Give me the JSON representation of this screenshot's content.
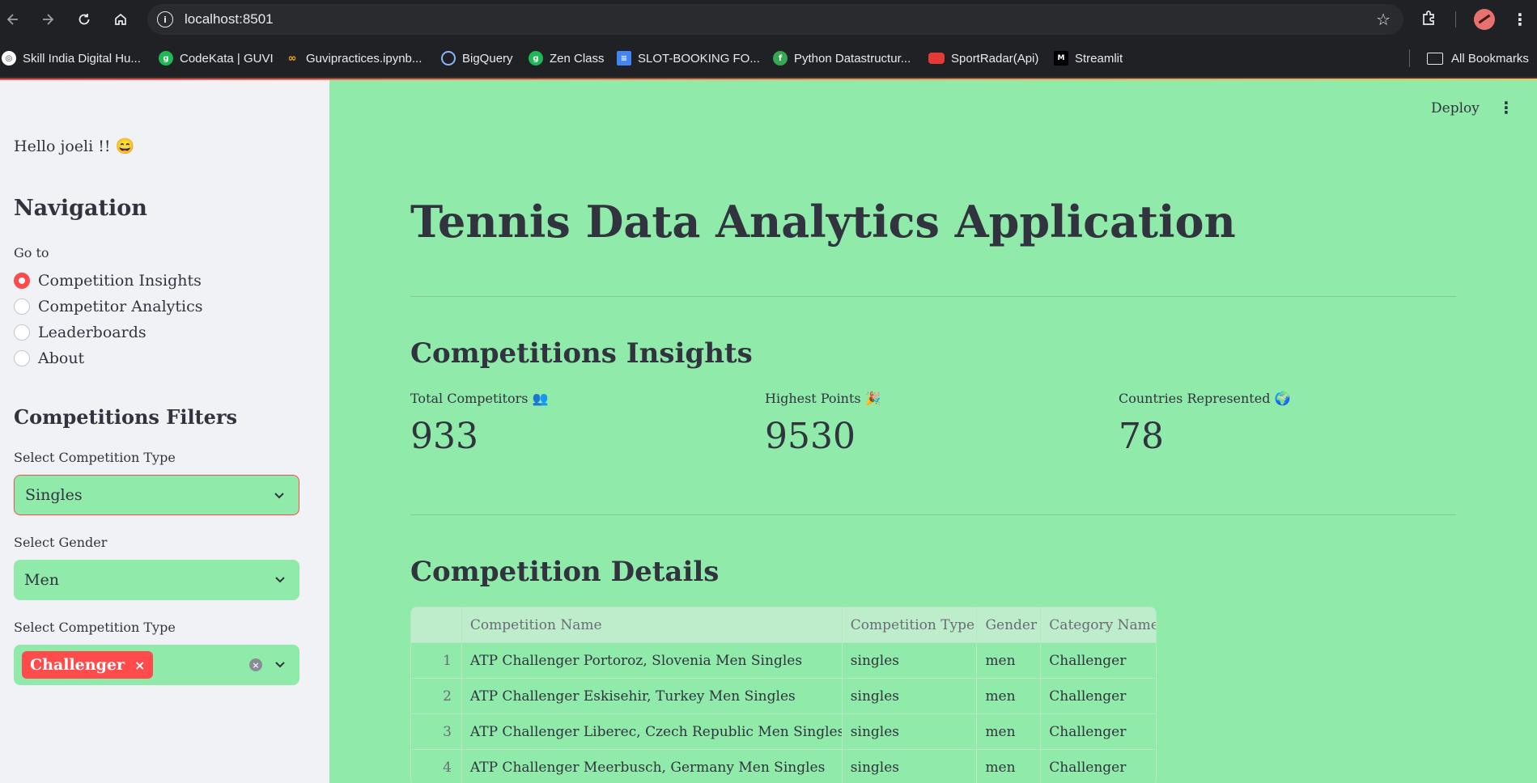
{
  "browser": {
    "url": "localhost:8501",
    "bookmarks": [
      {
        "label": "Skill India Digital Hu...",
        "icon": "skill-india-icon",
        "color": "#ffffff"
      },
      {
        "label": "CodeKata | GUVI",
        "icon": "guvi-icon",
        "color": "#1db954"
      },
      {
        "label": "Guvipractices.ipynb...",
        "icon": "colab-icon",
        "color": "#f9ab00"
      },
      {
        "label": "BigQuery",
        "icon": "bigquery-icon",
        "color": "#8ab4f8"
      },
      {
        "label": "Zen Class",
        "icon": "guvi-icon",
        "color": "#1db954"
      },
      {
        "label": "SLOT-BOOKING FO...",
        "icon": "docs-icon",
        "color": "#4285f4"
      },
      {
        "label": "Python Datastructur...",
        "icon": "python-icon",
        "color": "#34a853"
      },
      {
        "label": "SportRadar(Api)",
        "icon": "sportradar-icon",
        "color": "#e53935"
      },
      {
        "label": "Streamlit",
        "icon": "medium-icon",
        "color": "#000000"
      }
    ],
    "all_bookmarks_label": "All Bookmarks"
  },
  "sidebar": {
    "greeting": "Hello joeli !! 😄",
    "nav_heading": "Navigation",
    "goto_label": "Go to",
    "nav_items": [
      {
        "label": "Competition Insights",
        "selected": true
      },
      {
        "label": "Competitor Analytics",
        "selected": false
      },
      {
        "label": "Leaderboards",
        "selected": false
      },
      {
        "label": "About",
        "selected": false
      }
    ],
    "filters_heading": "Competitions Filters",
    "competition_type_label": "Select Competition Type",
    "competition_type_value": "Singles",
    "gender_label": "Select Gender",
    "gender_value": "Men",
    "category_label": "Select Competition Type",
    "category_tags": [
      "Challenger"
    ]
  },
  "main": {
    "deploy_label": "Deploy",
    "title": "Tennis Data Analytics Application",
    "insights_heading": "Competitions Insights",
    "metrics": [
      {
        "label": "Total Competitors 👥",
        "value": "933"
      },
      {
        "label": "Highest Points 🎉",
        "value": "9530"
      },
      {
        "label": "Countries Represented 🌍",
        "value": "78"
      }
    ],
    "details_heading": "Competition Details",
    "table": {
      "columns": [
        "",
        "Competition Name",
        "Competition Type",
        "Gender",
        "Category Name"
      ],
      "rows": [
        [
          "1",
          "ATP Challenger Portoroz, Slovenia Men Singles",
          "singles",
          "men",
          "Challenger"
        ],
        [
          "2",
          "ATP Challenger Eskisehir, Turkey Men Singles",
          "singles",
          "men",
          "Challenger"
        ],
        [
          "3",
          "ATP Challenger Liberec, Czech Republic Men Singles",
          "singles",
          "men",
          "Challenger"
        ],
        [
          "4",
          "ATP Challenger Meerbusch, Germany Men Singles",
          "singles",
          "men",
          "Challenger"
        ]
      ]
    }
  },
  "colors": {
    "accent": "#ff4b4b",
    "main_bg": "#90eaa9",
    "sidebar_bg": "#f0f2f6",
    "text": "#31333f"
  }
}
